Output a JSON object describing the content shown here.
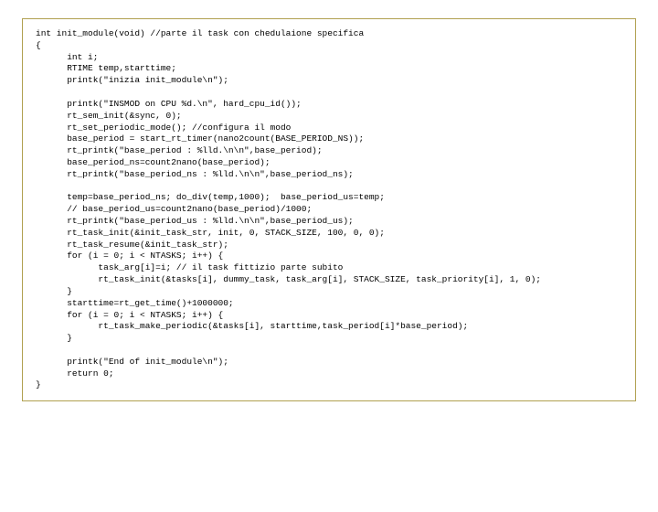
{
  "code": "int init_module(void) //parte il task con chedulaione specifica\n{\n      int i;\n      RTIME temp,starttime;\n      printk(\"inizia init_module\\n\");\n\n      printk(\"INSMOD on CPU %d.\\n\", hard_cpu_id());\n      rt_sem_init(&sync, 0);\n      rt_set_periodic_mode(); //configura il modo\n      base_period = start_rt_timer(nano2count(BASE_PERIOD_NS));\n      rt_printk(\"base_period : %lld.\\n\\n\",base_period);\n      base_period_ns=count2nano(base_period);\n      rt_printk(\"base_period_ns : %lld.\\n\\n\",base_period_ns);\n\n      temp=base_period_ns; do_div(temp,1000);  base_period_us=temp;\n      // base_period_us=count2nano(base_period)/1000;\n      rt_printk(\"base_period_us : %lld.\\n\\n\",base_period_us);\n      rt_task_init(&init_task_str, init, 0, STACK_SIZE, 100, 0, 0);\n      rt_task_resume(&init_task_str);\n      for (i = 0; i < NTASKS; i++) {\n            task_arg[i]=i; // il task fittizio parte subito\n            rt_task_init(&tasks[i], dummy_task, task_arg[i], STACK_SIZE, task_priority[i], 1, 0);\n      }\n      starttime=rt_get_time()+1000000;\n      for (i = 0; i < NTASKS; i++) {\n            rt_task_make_periodic(&tasks[i], starttime,task_period[i]*base_period);\n      }\n\n      printk(\"End of init_module\\n\");\n      return 0;\n}"
}
